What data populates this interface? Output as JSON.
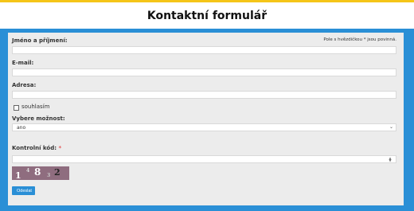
{
  "page": {
    "title": "Kontaktní formulář",
    "accent_color": "#f5c518",
    "panel_color": "#2a8fd6"
  },
  "form": {
    "required_note": "Pole s hvězdičkou * jsou povinná.",
    "name_label": "Jméno a příjmení:",
    "name_value": "",
    "email_label": "E-mail:",
    "email_value": "",
    "address_label": "Adresa:",
    "address_value": "",
    "consent_label": "souhlasím",
    "consent_checked": false,
    "select_label": "Vybere možnost:",
    "select_value": "ano",
    "captcha_label": "Kontrolní kód:",
    "captcha_required_mark": "*",
    "captcha_value": "",
    "captcha_chars": [
      "1",
      "4",
      "8",
      "3",
      "2"
    ],
    "submit_label": "Odeslat"
  }
}
